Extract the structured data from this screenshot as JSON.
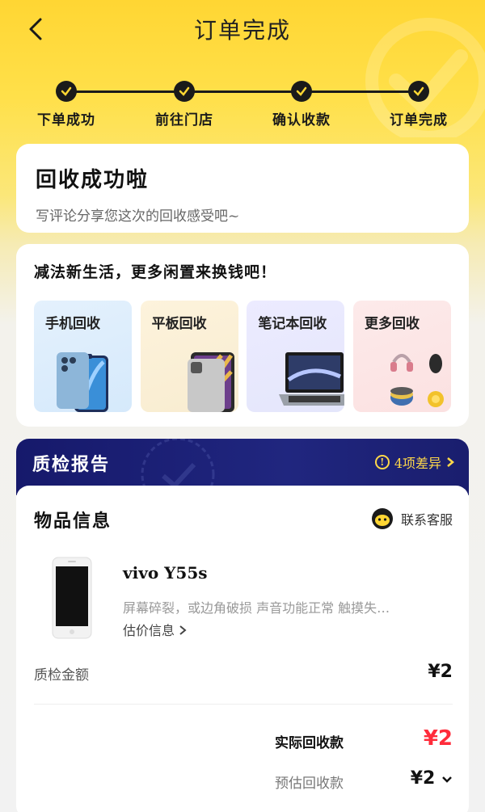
{
  "header": {
    "title": "订单完成",
    "back_icon": "chevron-left-icon"
  },
  "progress": {
    "steps": [
      {
        "label": "下单成功",
        "done": true
      },
      {
        "label": "前往门店",
        "done": true
      },
      {
        "label": "确认收款",
        "done": true
      },
      {
        "label": "订单完成",
        "done": true
      }
    ]
  },
  "success_card": {
    "title": "回收成功啦",
    "subtitle": "写评论分享您这次的回收感受吧~"
  },
  "recycle_card": {
    "title": "减法新生活，更多闲置来换钱吧！",
    "tiles": [
      {
        "label": "手机回收",
        "icon": "smartphone-icon"
      },
      {
        "label": "平板回收",
        "icon": "tablet-icon"
      },
      {
        "label": "笔记本回收",
        "icon": "laptop-icon"
      },
      {
        "label": "更多回收",
        "icon": "misc-goods-icon"
      }
    ]
  },
  "quality_report": {
    "title": "质检报告",
    "diff_label": "4项差异",
    "item_section_title": "物品信息",
    "contact_label": "联系客服",
    "product_name": "vivo Y55s",
    "product_desc": "屏幕碎裂，或边角破损 声音功能正常 触摸失…",
    "estimate_info": "估价信息",
    "qa_amount_label": "质检金额",
    "qa_amount_value": "¥2",
    "actual_label": "实际回收款",
    "actual_value": "¥2",
    "estimated_label": "预估回收款",
    "estimated_value": "¥2"
  },
  "colors": {
    "brand_yellow": "#ffd633",
    "report_navy": "#1a1e6e",
    "price_red": "#ff2c3b"
  }
}
